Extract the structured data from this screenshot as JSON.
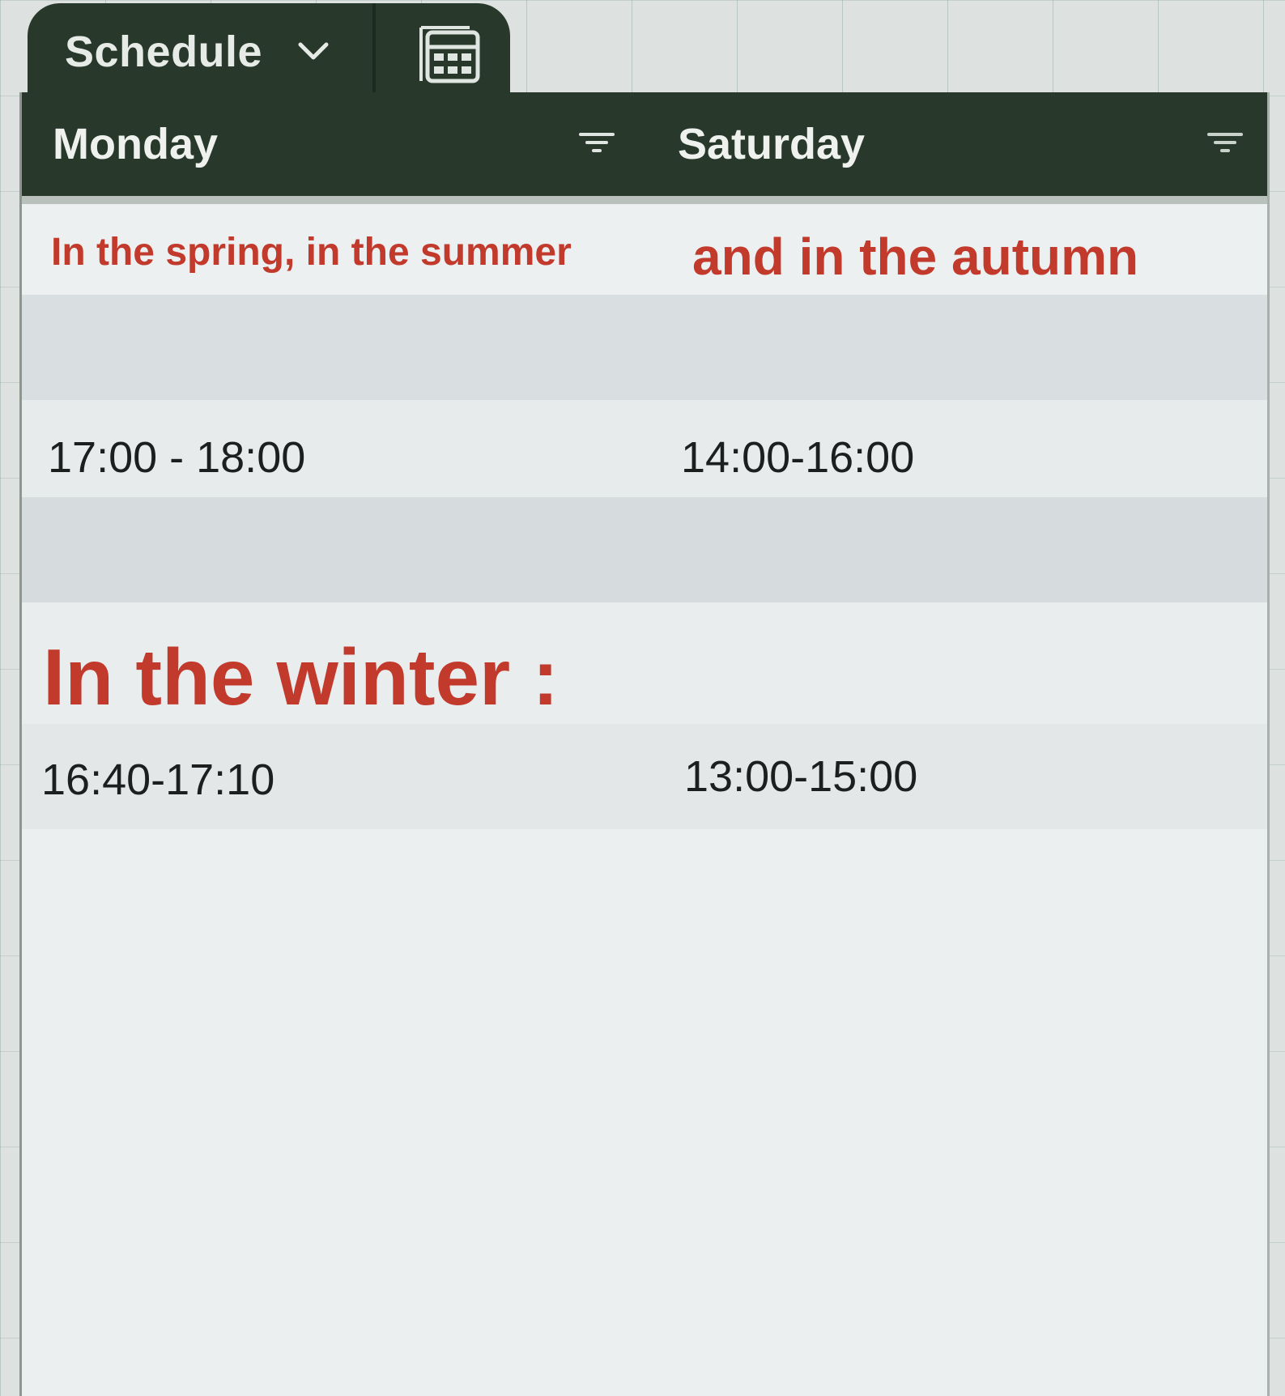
{
  "sheet_tab": {
    "title": "Schedule"
  },
  "columns": [
    {
      "label": "Monday"
    },
    {
      "label": "Saturday"
    }
  ],
  "rows": {
    "spring_summer_label": "In the spring, in the summer",
    "autumn_label": "and in the autumn",
    "spring_monday": "17:00 - 18:00",
    "spring_saturday": "14:00-16:00",
    "winter_label": "In the winter :",
    "winter_monday": "16:40-17:10",
    "winter_saturday": "13:00-15:00"
  },
  "colors": {
    "header_bg": "#28392b",
    "accent_red": "#c23a2c"
  },
  "icons": [
    "chevron-down-icon",
    "calendar-grid-icon",
    "filter-icon"
  ]
}
